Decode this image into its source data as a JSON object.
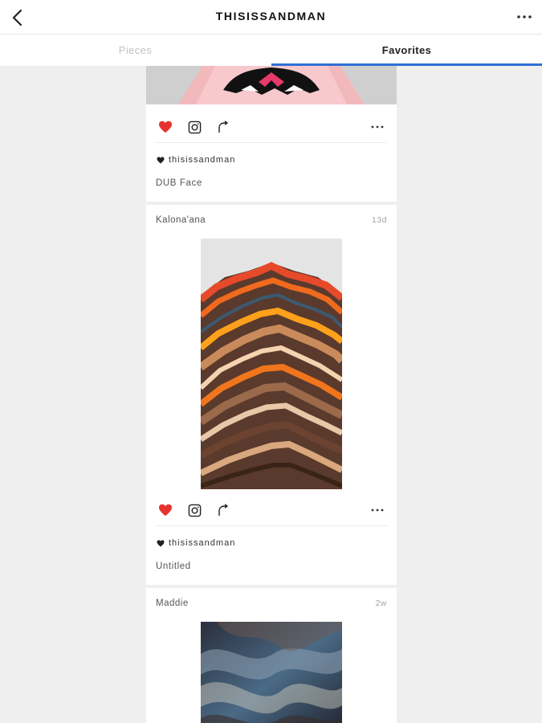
{
  "header": {
    "title": "THISISSANDMAN",
    "back_icon": "chevron-left-icon",
    "more_icon": "more-horizontal-icon"
  },
  "tabs": [
    {
      "label": "Pieces",
      "active": false
    },
    {
      "label": "Favorites",
      "active": true
    }
  ],
  "colors": {
    "accent": "#2f6fd8",
    "heart": "#e5342f",
    "background": "#efefef"
  },
  "posts": [
    {
      "author": "",
      "age": "",
      "favorited_by": "thisissandman",
      "title": "DUB Face",
      "liked": true
    },
    {
      "author": "Kalona'ana",
      "age": "13d",
      "favorited_by": "thisissandman",
      "title": "Untitled",
      "liked": true
    },
    {
      "author": "Maddie",
      "age": "2w"
    }
  ]
}
